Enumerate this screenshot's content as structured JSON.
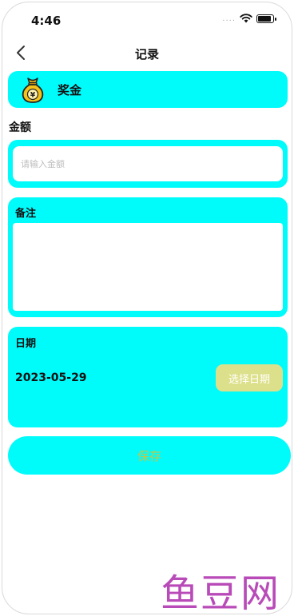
{
  "status_bar": {
    "time": "4:46",
    "signal_dots": "....",
    "icons": [
      "wifi-icon",
      "battery-icon"
    ]
  },
  "nav": {
    "title": "记录",
    "back_icon": "chevron-left-icon"
  },
  "category": {
    "icon": "money-bag-icon",
    "label": "奖金"
  },
  "amount": {
    "label": "金额",
    "value": "",
    "placeholder": "请输入金额"
  },
  "note": {
    "label": "备注",
    "value": ""
  },
  "date": {
    "label": "日期",
    "value": "2023-05-29",
    "button_label": "选择日期"
  },
  "save": {
    "label": "保存"
  },
  "watermark": {
    "text": "鱼豆网"
  },
  "colors": {
    "panel": "#00fbfb",
    "date_button": "#dde08a",
    "save_text": "#c8c640",
    "watermark": "#b84bb8"
  }
}
